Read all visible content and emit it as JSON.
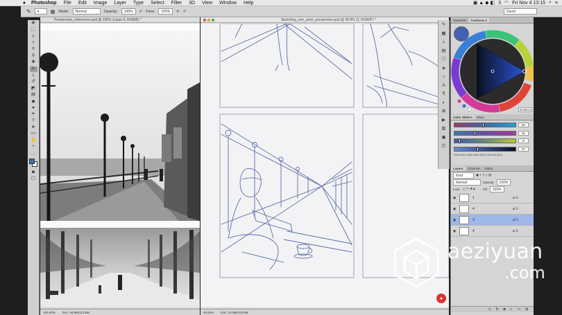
{
  "menubar": {
    "app": "Photoshop",
    "menus": [
      "File",
      "Edit",
      "Image",
      "Layer",
      "Type",
      "Select",
      "Filter",
      "3D",
      "View",
      "Window",
      "Help"
    ],
    "battery_indicator": "3",
    "clock": "Fri Nov 4  13:15"
  },
  "options": {
    "mode_label": "Mode:",
    "mode_value": "Normal",
    "opacity_label": "Opacity:",
    "opacity_value": "100%",
    "flow_label": "Flow:",
    "flow_value": "100%",
    "workspace": "David"
  },
  "documents": {
    "left_title": "Perspective_references.psd @ 100% (Layer 6, RGB/8) *",
    "left_zoom": "100.00%",
    "left_doc_size": "Doc: 26.9M/113.8M",
    "right_title": "Sketching_one_point_perspective.psd @ 49.8% (3, RGB/8*) *",
    "right_zoom": "49.84%",
    "right_doc_size": "Doc: 20.9M/103.9M"
  },
  "color_panel": {
    "tabs": [
      "Swatches",
      "Coolorus 2"
    ],
    "hex_value": "3A6EA1",
    "sliders_tabs": [
      "Color Sliders",
      "Mixer"
    ],
    "slider_values": [
      "65",
      "32",
      "8",
      "37"
    ],
    "modes_text": "RGB  HSV  HSB  LAB  CMYK  GRAYSCALE"
  },
  "layers_panel": {
    "tabs": [
      "Layers",
      "Channels",
      "Paths"
    ],
    "kind_label": "Kind",
    "blend_mode": "Normal",
    "opacity_label": "Opacity:",
    "opacity_value": "100%",
    "lock_label": "Lock:",
    "fill_label": "Fill:",
    "fill_value": "100%",
    "layers": [
      {
        "name": "1",
        "selected": false
      },
      {
        "name": "4",
        "selected": false
      },
      {
        "name": "3",
        "selected": true
      },
      {
        "name": "4",
        "selected": false
      }
    ]
  },
  "watermark": {
    "text": "aeziyuan",
    "sub": ".com"
  },
  "colors": {
    "foreground": "#4a6ab3",
    "selection": "#9fb8e8",
    "sketch_line": "#5a6ea6"
  }
}
